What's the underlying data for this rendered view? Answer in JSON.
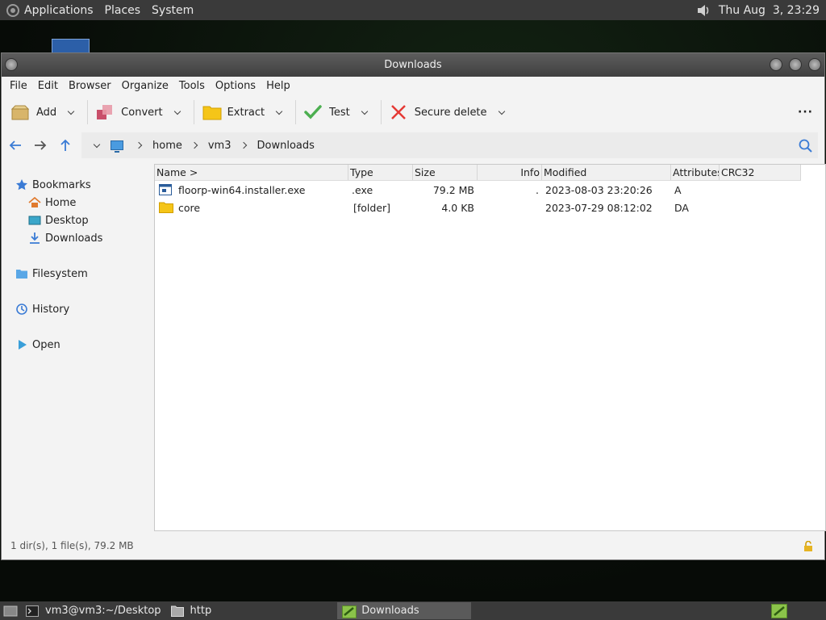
{
  "top_panel": {
    "menus": [
      "Applications",
      "Places",
      "System"
    ],
    "clock": "Thu Aug  3, 23:29"
  },
  "window": {
    "title": "Downloads",
    "menubar": [
      "File",
      "Edit",
      "Browser",
      "Organize",
      "Tools",
      "Options",
      "Help"
    ],
    "toolbar": {
      "add": "Add",
      "convert": "Convert",
      "extract": "Extract",
      "test": "Test",
      "secure_delete": "Secure delete",
      "more": "···"
    },
    "path": [
      "home",
      "vm3",
      "Downloads"
    ],
    "sidebar": {
      "bookmarks": "Bookmarks",
      "home": "Home",
      "desktop": "Desktop",
      "downloads": "Downloads",
      "filesystem": "Filesystem",
      "history": "History",
      "open": "Open"
    },
    "columns": [
      "Name >",
      "Type",
      "Size",
      "Info",
      "Modified",
      "Attributes",
      "CRC32"
    ],
    "files": [
      {
        "name": "floorp-win64.installer.exe",
        "type": ".exe",
        "size": "79.2 MB",
        "info": ".",
        "modified": "2023-08-03 23:20:26",
        "attributes": "A",
        "crc32": "",
        "icon": "exe-icon"
      },
      {
        "name": "core",
        "type": "[folder]",
        "size": "4.0 KB",
        "info": "",
        "modified": "2023-07-29 08:12:02",
        "attributes": "DA",
        "crc32": "",
        "icon": "folder-icon"
      }
    ],
    "status": "1 dir(s), 1 file(s), 79.2 MB"
  },
  "taskbar": {
    "terminal": "vm3@vm3:~/Desktop",
    "folder": "http",
    "downloads": "Downloads"
  },
  "colors": {
    "accent": "#3a7bd5",
    "panel": "#3a3a3a",
    "folder": "#f5c518",
    "test_check": "#4caf50",
    "delete_x": "#e53935"
  }
}
